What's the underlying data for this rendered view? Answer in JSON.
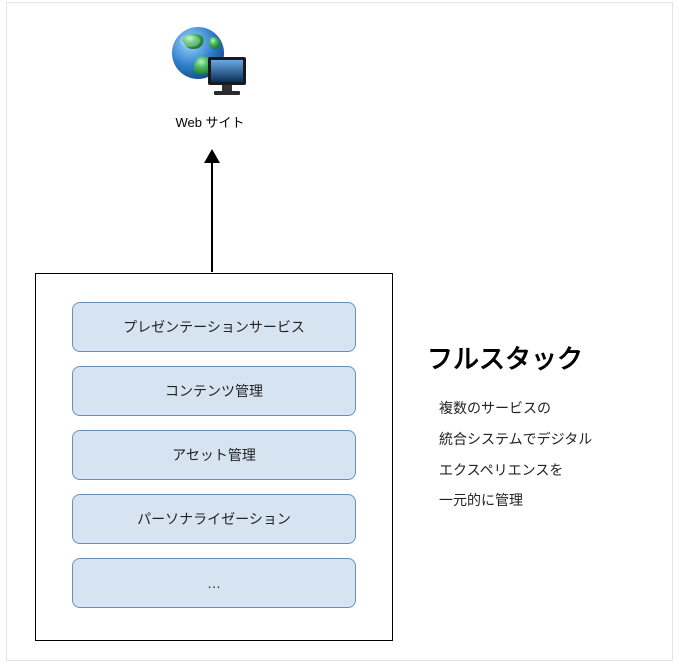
{
  "top": {
    "icon": "globe-monitor",
    "label": "Web サイト"
  },
  "stack": {
    "services": [
      "プレゼンテーションサービス",
      "コンテンツ管理",
      "アセット管理",
      "パーソナライゼーション",
      "…"
    ]
  },
  "right": {
    "title": "フルスタック",
    "desc_lines": [
      "複数のサービスの",
      "統合システムでデジタル",
      "エクスペリエンスを",
      "一元的に管理"
    ]
  }
}
